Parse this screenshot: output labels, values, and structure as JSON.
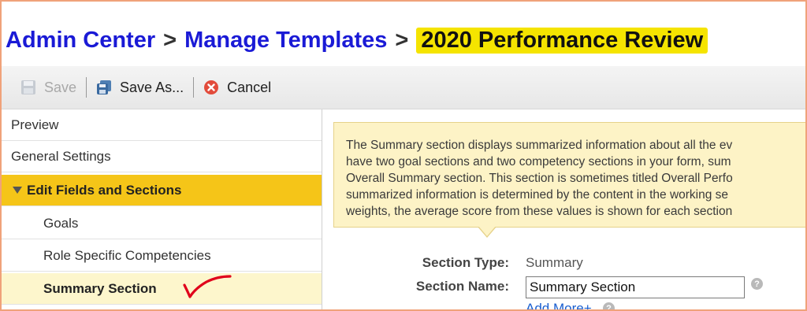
{
  "breadcrumb": {
    "items": [
      "Admin Center",
      "Manage Templates"
    ],
    "separator": ">",
    "current": "2020 Performance Review"
  },
  "toolbar": {
    "save_label": "Save",
    "save_as_label": "Save As...",
    "cancel_label": "Cancel"
  },
  "sidebar": {
    "items": [
      {
        "label": "Preview"
      },
      {
        "label": "General Settings"
      },
      {
        "label": "Edit Fields and Sections"
      },
      {
        "label": "Goals"
      },
      {
        "label": "Role Specific Competencies"
      },
      {
        "label": "Summary Section"
      }
    ]
  },
  "tooltip": {
    "lines": [
      "The Summary section displays summarized information about all the ev",
      "have two goal sections and two competency sections in your form, sum",
      "Overall Summary section. This section is sometimes titled Overall Perfo",
      "summarized information is determined by the content in the working se",
      "weights, the average score from these values is shown for each section"
    ]
  },
  "form": {
    "section_type_label": "Section Type:",
    "section_type_value": "Summary",
    "section_name_label": "Section Name:",
    "section_name_value": "Summary Section",
    "add_more_label": "Add More+"
  },
  "colors": {
    "breadcrumb_link": "#1a1ad6",
    "highlight": "#f5e400",
    "section_head_bg": "#f5c518",
    "active_bg": "#fdf6cc",
    "tooltip_bg": "#fdf3c6",
    "annotation_check": "#e0001b"
  },
  "icons": {
    "save": "floppy-disk-icon",
    "save_as": "save-as-icon",
    "cancel": "cancel-x-circle-icon",
    "help": "question-mark-icon"
  }
}
